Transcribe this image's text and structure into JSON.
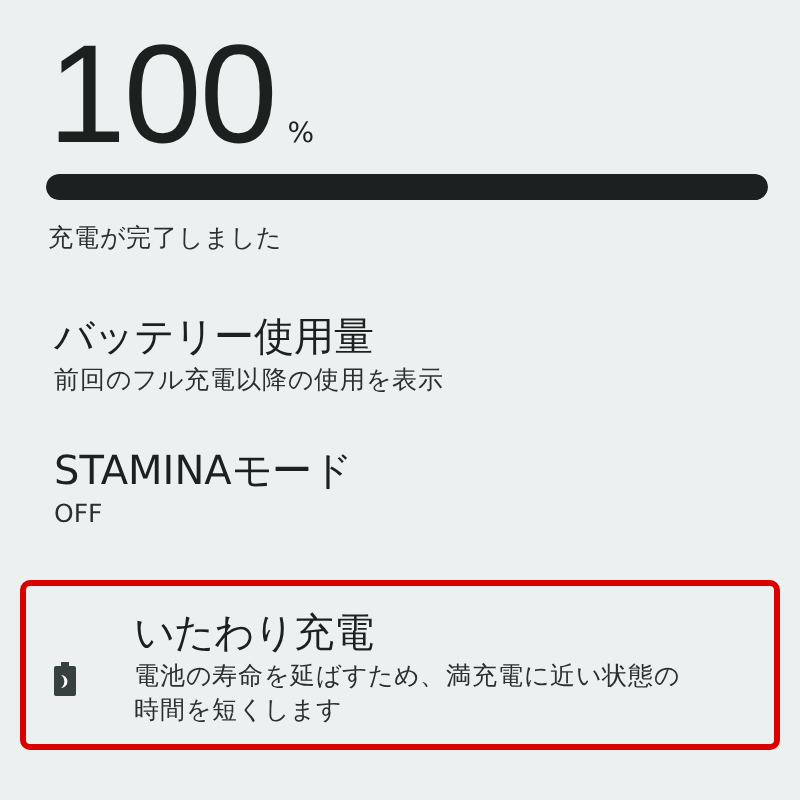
{
  "battery": {
    "value": "100",
    "unit": "%",
    "level": 1,
    "status": "充電が完了しました"
  },
  "items": [
    {
      "kind": "plain",
      "title": "バッテリー使用量",
      "summary": "前回のフル充電以降の使用を表示",
      "highlighted": false
    },
    {
      "kind": "plain",
      "title": "STAMINAモード",
      "summary": "OFF",
      "highlighted": false
    },
    {
      "kind": "icon",
      "title": "いたわり充電",
      "summary": "電池の寿命を延ばすため、満充電に近い状態の時間を短くします",
      "highlighted": true
    }
  ]
}
